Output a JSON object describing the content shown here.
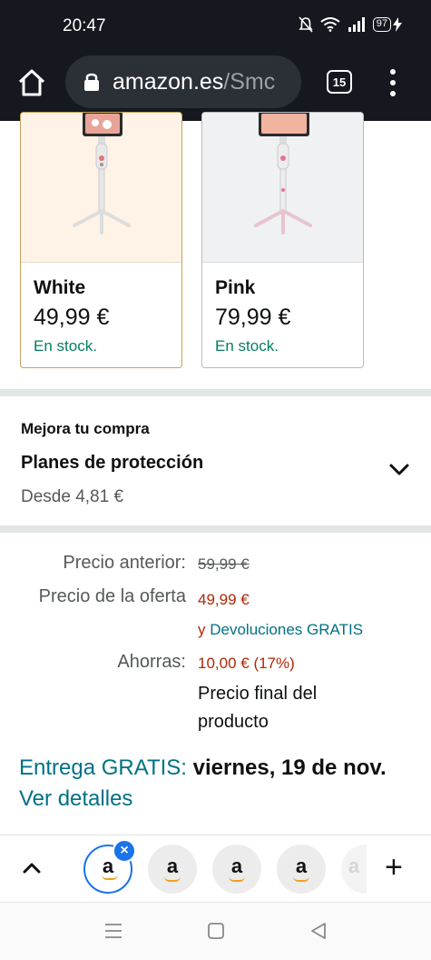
{
  "status": {
    "time": "20:47",
    "battery": "97"
  },
  "browser": {
    "domain": "amazon.es",
    "path": "/Smc",
    "tab_count": "15"
  },
  "variants": [
    {
      "name": "White",
      "price": "49,99 €",
      "stock": "En stock."
    },
    {
      "name": "Pink",
      "price": "79,99 €",
      "stock": "En stock."
    }
  ],
  "protection": {
    "kicker": "Mejora tu compra",
    "title": "Planes de protección",
    "from": "Desde 4,81 €"
  },
  "pricing": {
    "previous_label": "Precio anterior:",
    "previous_value": "59,99 €",
    "offer_label": "Precio de la oferta",
    "offer_value": "49,99 €",
    "returns_prefix": "y",
    "returns_link": "Devoluciones GRATIS",
    "savings_label": "Ahorras:",
    "savings_value": "10,00 € (17%)",
    "final_line1": "Precio final del",
    "final_line2": "producto"
  },
  "delivery": {
    "label": "Entrega GRATIS:",
    "date": "viernes, 19 de nov.",
    "details": "Ver detalles"
  },
  "tabstrip": {
    "favicon_letter": "a",
    "close": "×",
    "add": "+"
  },
  "colors": {
    "accent": "#007185",
    "price_red": "#b12704",
    "stock_green": "#067d62",
    "selected_border": "#c7a15a",
    "tab_blue": "#1a73e8"
  }
}
